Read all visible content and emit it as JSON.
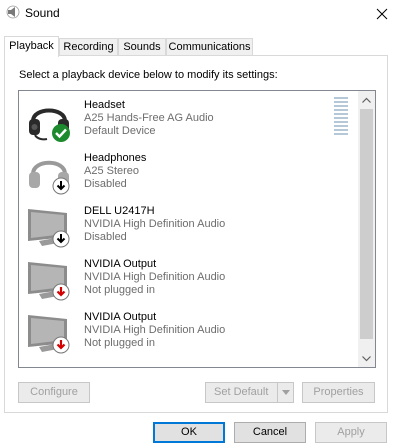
{
  "window": {
    "title": "Sound",
    "icon": "speaker-icon",
    "close_icon": "close-icon"
  },
  "tabs": [
    {
      "label": "Playback",
      "active": true
    },
    {
      "label": "Recording",
      "active": false
    },
    {
      "label": "Sounds",
      "active": false
    },
    {
      "label": "Communications",
      "active": false
    }
  ],
  "instruction": "Select a playback device below to modify its settings:",
  "devices": [
    {
      "name": "Headset",
      "driver": "A25 Hands-Free AG Audio",
      "status": "Default Device",
      "icon": "headset-icon",
      "badge": "green-check-badge"
    },
    {
      "name": "Headphones",
      "driver": "A25 Stereo",
      "status": "Disabled",
      "icon": "headphones-icon",
      "badge": "disabled-down-arrow-badge"
    },
    {
      "name": "DELL U2417H",
      "driver": "NVIDIA High Definition Audio",
      "status": "Disabled",
      "icon": "monitor-icon",
      "badge": "disabled-down-arrow-badge"
    },
    {
      "name": "NVIDIA Output",
      "driver": "NVIDIA High Definition Audio",
      "status": "Not plugged in",
      "icon": "monitor-icon",
      "badge": "unplugged-red-arrow-badge"
    },
    {
      "name": "NVIDIA Output",
      "driver": "NVIDIA High Definition Audio",
      "status": "Not plugged in",
      "icon": "monitor-icon",
      "badge": "unplugged-red-arrow-badge"
    }
  ],
  "panel_buttons": {
    "configure": "Configure",
    "set_default": "Set Default",
    "properties": "Properties"
  },
  "dialog_buttons": {
    "ok": "OK",
    "cancel": "Cancel",
    "apply": "Apply"
  },
  "colors": {
    "accent": "#0078d7",
    "check_green": "#1e8a2e",
    "unplugged_red": "#d40000"
  }
}
